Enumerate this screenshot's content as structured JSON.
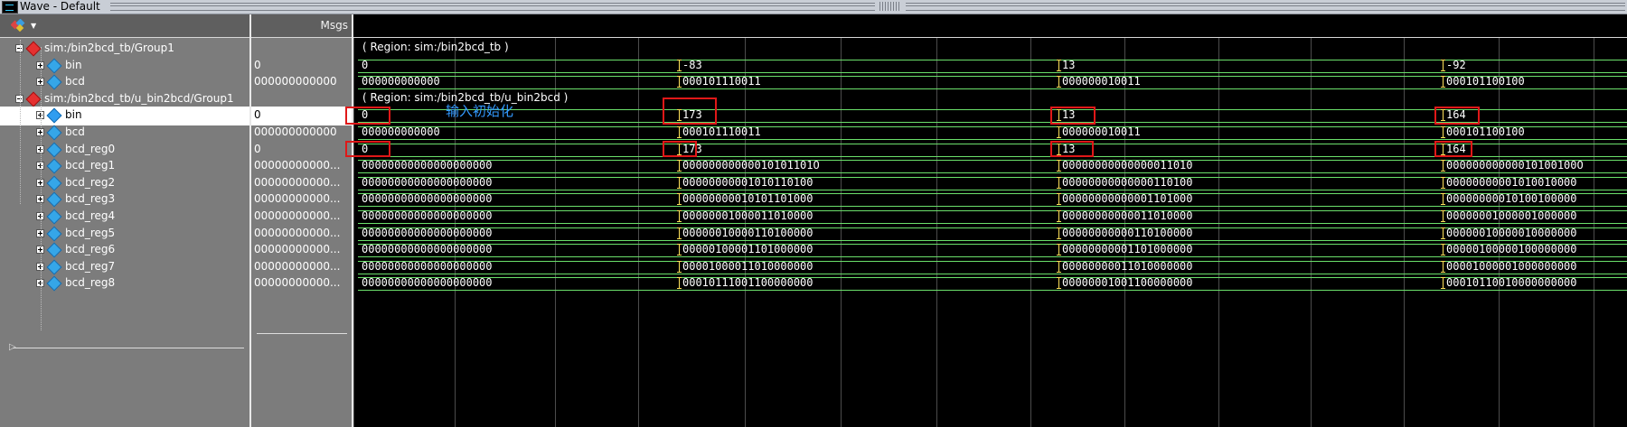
{
  "window": {
    "title": "Wave - Default"
  },
  "header": {
    "msgs_label": "Msgs"
  },
  "signals": [
    {
      "name": "sim:/bin2bcd_tb/Group1",
      "value": "",
      "kind": "group"
    },
    {
      "name": "bin",
      "value": "0",
      "kind": "signal"
    },
    {
      "name": "bcd",
      "value": "000000000000",
      "kind": "signal"
    },
    {
      "name": "sim:/bin2bcd_tb/u_bin2bcd/Group1",
      "value": "",
      "kind": "group"
    },
    {
      "name": "bin",
      "value": "0",
      "kind": "signal",
      "selected": true
    },
    {
      "name": "bcd",
      "value": "000000000000",
      "kind": "signal"
    },
    {
      "name": "bcd_reg0",
      "value": "0",
      "kind": "signal"
    },
    {
      "name": "bcd_reg1",
      "value": "00000000000...",
      "kind": "signal"
    },
    {
      "name": "bcd_reg2",
      "value": "00000000000...",
      "kind": "signal"
    },
    {
      "name": "bcd_reg3",
      "value": "00000000000...",
      "kind": "signal"
    },
    {
      "name": "bcd_reg4",
      "value": "00000000000...",
      "kind": "signal"
    },
    {
      "name": "bcd_reg5",
      "value": "00000000000...",
      "kind": "signal"
    },
    {
      "name": "bcd_reg6",
      "value": "00000000000...",
      "kind": "signal"
    },
    {
      "name": "bcd_reg7",
      "value": "00000000000...",
      "kind": "signal"
    },
    {
      "name": "bcd_reg8",
      "value": "00000000000...",
      "kind": "signal"
    }
  ],
  "wave_rows": [
    {
      "region": "( Region: sim:/bin2bcd_tb )"
    },
    {
      "segments": [
        "0",
        "-83",
        "13",
        "-92"
      ]
    },
    {
      "segments": [
        "000000000000",
        "000101110011",
        "000000010011",
        "000101100100"
      ]
    },
    {
      "region": "( Region: sim:/bin2bcd_tb/u_bin2bcd )"
    },
    {
      "segments": [
        "0",
        "173",
        "13",
        "164"
      ]
    },
    {
      "segments": [
        "000000000000",
        "000101110011",
        "000000010011",
        "000101100100"
      ]
    },
    {
      "segments": [
        "0",
        "173",
        "13",
        "164"
      ]
    },
    {
      "segments": [
        "00000000000000000000",
        "00000000000010101101O",
        "00000000000000011010",
        "00000000000010100100O"
      ]
    },
    {
      "segments": [
        "00000000000000000000",
        "00000000001010110100",
        "00000000000000110100",
        "00000000001010010000"
      ]
    },
    {
      "segments": [
        "00000000000000000000",
        "00000000010101101000",
        "00000000000001101000",
        "00000000010100100000"
      ]
    },
    {
      "segments": [
        "00000000000000000000",
        "00000001000011010000",
        "00000000000011010000",
        "00000001000001000000"
      ]
    },
    {
      "segments": [
        "00000000000000000000",
        "00000010000110100000",
        "00000000000110100000",
        "00000010000010000000"
      ]
    },
    {
      "segments": [
        "00000000000000000000",
        "00000100001101000000",
        "00000000001101000000",
        "00000100000100000000"
      ]
    },
    {
      "segments": [
        "00000000000000000000",
        "00001000011010000000",
        "00000000011010000000",
        "00001000001000000000"
      ]
    },
    {
      "segments": [
        "00000000000000000000",
        "00010111001100000000",
        "00000001001100000000",
        "00010110010000000000"
      ]
    }
  ],
  "annotation": {
    "text": "输入初始化",
    "color": "#3399ff"
  },
  "colors": {
    "bus": "#6be06b",
    "transition": "#ffe25a",
    "highlight": "#e01818",
    "grid": "#4c4c4c"
  }
}
